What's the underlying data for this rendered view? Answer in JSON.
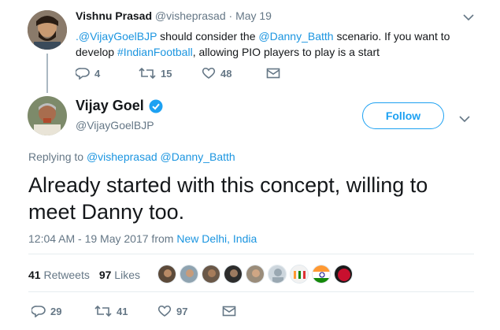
{
  "prev_tweet": {
    "author_name": "Vishnu Prasad",
    "handle": "@visheprasad",
    "separator": "·",
    "date": "May 19",
    "text_mention1": ".@VijayGoelBJP",
    "text_part1": " should consider the ",
    "text_mention2": "@Danny_Batth",
    "text_part2": " scenario. If you want to",
    "text_part3": "develop ",
    "text_hashtag": "#IndianFootball",
    "text_part4": ", allowing PIO players to play is a start",
    "replies": "4",
    "retweets": "15",
    "likes": "48"
  },
  "main_tweet": {
    "author_name": "Vijay Goel",
    "handle": "@VijayGoelBJP",
    "follow_label": "Follow",
    "replying_prefix": "Replying to ",
    "replying_to_1": "@visheprasad",
    "replying_to_2": "@Danny_Batth",
    "text_line1": "Already started with this concept, willing to",
    "text_line2": "meet Danny too.",
    "timestamp": "12:04 AM - 19 May 2017 from ",
    "location": "New Delhi, India",
    "retweets_count": "41",
    "retweets_label": "Retweets",
    "likes_count": "97",
    "likes_label": "Likes",
    "replies": "29",
    "retweets": "41",
    "likes": "97"
  },
  "colors": {
    "link": "#1b95e0",
    "verified": "#1da1f2",
    "muted": "#657786",
    "text": "#14171a"
  },
  "icons": [
    "chevron-down-icon",
    "reply-icon",
    "retweet-icon",
    "heart-icon",
    "envelope-icon",
    "verified-badge-icon"
  ]
}
